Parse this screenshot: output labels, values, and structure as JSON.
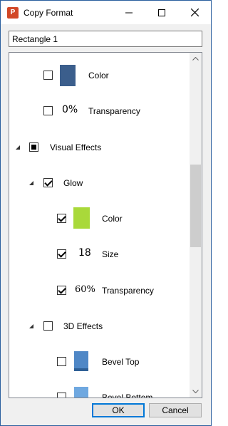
{
  "window": {
    "title": "Copy Format",
    "app_icon": "powerpoint-icon"
  },
  "title_controls": {
    "minimize_icon": "minimize-icon",
    "maximize_icon": "maximize-icon",
    "close_icon": "close-icon"
  },
  "search": {
    "value": "Rectangle 1"
  },
  "tree": {
    "items": [
      {
        "label": "Color",
        "checked": false,
        "swatch_color": "#3b5e8c"
      },
      {
        "label": "Transparency",
        "checked": false,
        "value": "0%"
      },
      {
        "label": "Visual Effects",
        "state": "indeterminate",
        "expanded": true
      },
      {
        "label": "Glow",
        "checked": true,
        "expanded": true
      },
      {
        "label": "Color",
        "checked": true,
        "swatch_color": "#a9d93a"
      },
      {
        "label": "Size",
        "checked": true,
        "value": "18"
      },
      {
        "label": "Transparency",
        "checked": true,
        "value": "60%"
      },
      {
        "label": "3D Effects",
        "checked": false,
        "expanded": true
      },
      {
        "label": "Bevel Top",
        "checked": false,
        "swatch_color": "#4f87c6"
      },
      {
        "label": "Bevel Bottom",
        "checked": false,
        "swatch_color": "#6fa8e0"
      }
    ]
  },
  "buttons": {
    "ok": "OK",
    "cancel": "Cancel"
  }
}
